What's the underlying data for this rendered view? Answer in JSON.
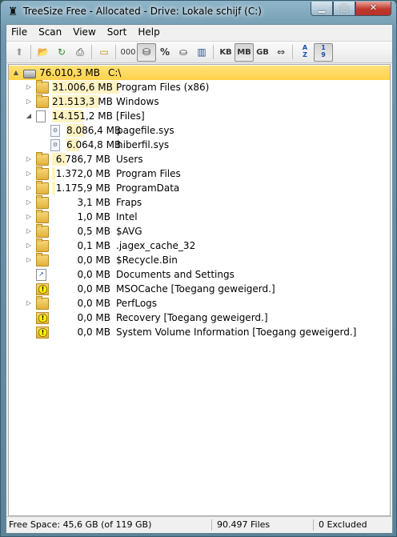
{
  "window": {
    "title": "TreeSize Free - Allocated - Drive: Lokale schijf (C:)"
  },
  "menu": [
    "File",
    "Scan",
    "View",
    "Sort",
    "Help"
  ],
  "toolbar": {
    "kb": "KB",
    "mb": "MB",
    "gb": "GB",
    "percent": "%",
    "zeros": "000",
    "sort_az_top": "A",
    "sort_az_bottom": "Z",
    "sort_19_top": "1",
    "sort_19_bottom": "9"
  },
  "tree": [
    {
      "size": "76.010,3 MB",
      "name": "C:\\",
      "icon": "drive-icon",
      "expander": "▲",
      "fill": 1.0,
      "selected": true
    },
    {
      "size": "31.006,6 MB",
      "name": "Program Files (x86)",
      "icon": "folder-icon",
      "expander": "▷",
      "fill": 0.408
    },
    {
      "size": "21.513,3 MB",
      "name": "Windows",
      "icon": "folder-icon",
      "expander": "▷",
      "fill": 0.283
    },
    {
      "size": "14.151,2 MB",
      "name": "[Files]",
      "icon": "file-icon",
      "expander": "◢",
      "fill": 0.186
    },
    {
      "size": "8.086,4 MB",
      "name": "pagefile.sys",
      "icon": "system-file-icon",
      "expander": "",
      "fill": 0.106,
      "child": true
    },
    {
      "size": "6.064,8 MB",
      "name": "hiberfil.sys",
      "icon": "system-file-icon",
      "expander": "",
      "fill": 0.08,
      "child": true
    },
    {
      "size": "6.786,7 MB",
      "name": "Users",
      "icon": "folder-icon",
      "expander": "▷",
      "fill": 0.089
    },
    {
      "size": "1.372,0 MB",
      "name": "Program Files",
      "icon": "folder-icon",
      "expander": "▷",
      "fill": 0.018
    },
    {
      "size": "1.175,9 MB",
      "name": "ProgramData",
      "icon": "folder-icon",
      "expander": "▷",
      "fill": 0.015
    },
    {
      "size": "3,1 MB",
      "name": "Fraps",
      "icon": "folder-icon",
      "expander": "▷",
      "fill": 0
    },
    {
      "size": "1,0 MB",
      "name": "Intel",
      "icon": "folder-icon",
      "expander": "▷",
      "fill": 0
    },
    {
      "size": "0,5 MB",
      "name": "$AVG",
      "icon": "folder-icon",
      "expander": "▷",
      "fill": 0
    },
    {
      "size": "0,1 MB",
      "name": ".jagex_cache_32",
      "icon": "folder-icon",
      "expander": "▷",
      "fill": 0
    },
    {
      "size": "0,0 MB",
      "name": "$Recycle.Bin",
      "icon": "folder-icon",
      "expander": "▷",
      "fill": 0
    },
    {
      "size": "0,0 MB",
      "name": "Documents and Settings",
      "icon": "shortcut-icon",
      "expander": "",
      "fill": 0
    },
    {
      "size": "0,0 MB",
      "name": "MSOCache  [Toegang geweigerd.]",
      "icon": "warning-folder-icon",
      "expander": "",
      "fill": 0
    },
    {
      "size": "0,0 MB",
      "name": "PerfLogs",
      "icon": "folder-icon",
      "expander": "▷",
      "fill": 0
    },
    {
      "size": "0,0 MB",
      "name": "Recovery  [Toegang geweigerd.]",
      "icon": "warning-folder-icon",
      "expander": "",
      "fill": 0
    },
    {
      "size": "0,0 MB",
      "name": "System Volume Information  [Toegang geweigerd.]",
      "icon": "warning-folder-icon",
      "expander": "",
      "fill": 0
    }
  ],
  "status": {
    "free_space": "Free Space: 45,6 GB  (of 119 GB)",
    "files": "90.497  Files",
    "excluded": "0 Excluded"
  }
}
